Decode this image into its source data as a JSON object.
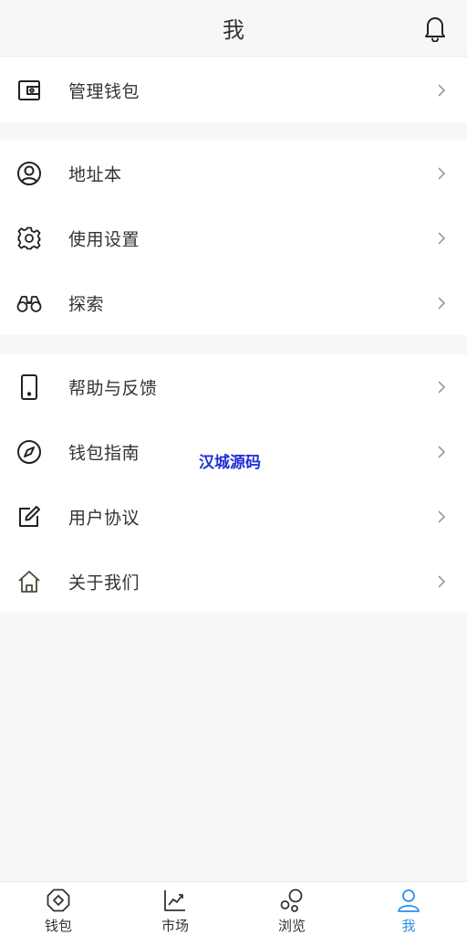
{
  "header": {
    "title": "我"
  },
  "groups": [
    {
      "items": [
        {
          "label": "管理钱包",
          "icon": "wallet-icon"
        }
      ]
    },
    {
      "items": [
        {
          "label": "地址本",
          "icon": "user-circle-icon"
        },
        {
          "label": "使用设置",
          "icon": "gear-icon"
        },
        {
          "label": "探索",
          "icon": "binoculars-icon"
        }
      ]
    },
    {
      "items": [
        {
          "label": "帮助与反馈",
          "icon": "phone-icon"
        },
        {
          "label": "钱包指南",
          "icon": "compass-icon"
        },
        {
          "label": "用户协议",
          "icon": "edit-icon"
        },
        {
          "label": "关于我们",
          "icon": "home-icon"
        }
      ]
    }
  ],
  "watermark": "汉城源码",
  "tabbar": {
    "tabs": [
      {
        "label": "钱包",
        "icon": "wallet-coin-icon"
      },
      {
        "label": "市场",
        "icon": "chart-icon"
      },
      {
        "label": "浏览",
        "icon": "bubbles-icon"
      },
      {
        "label": "我",
        "icon": "person-icon"
      }
    ],
    "active_color": "#2f8fe8"
  }
}
